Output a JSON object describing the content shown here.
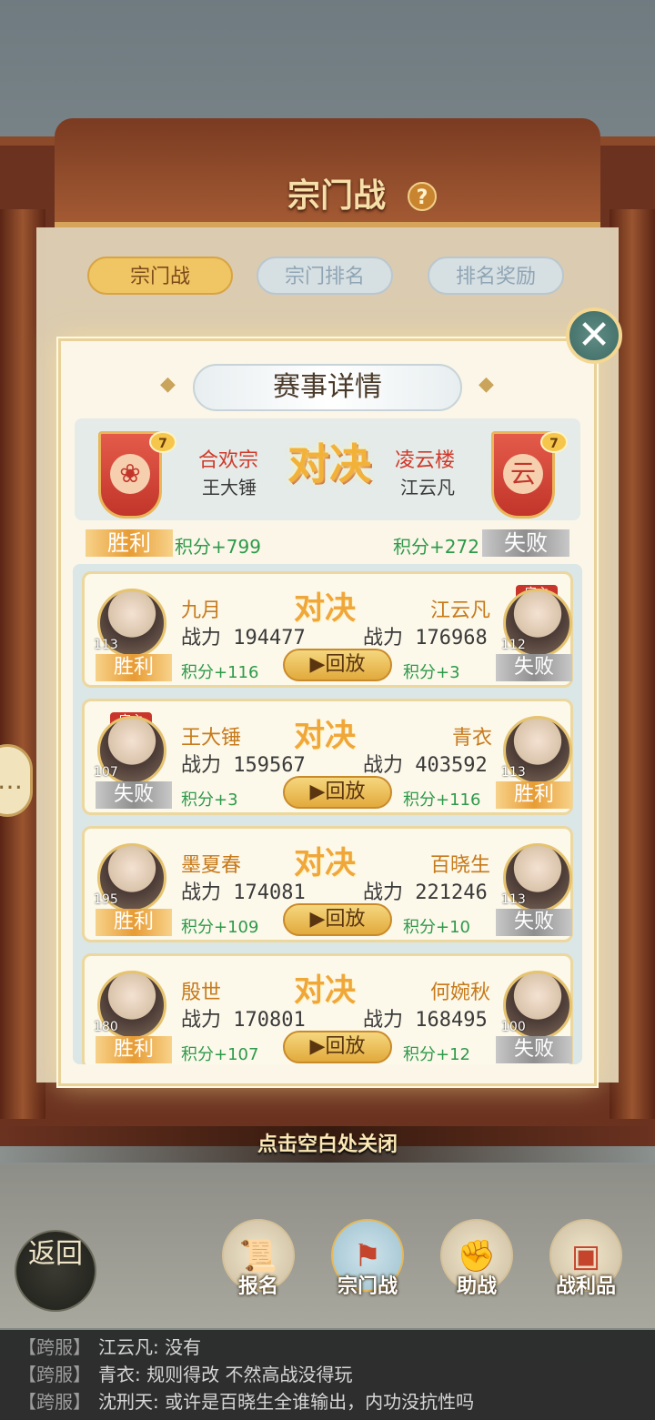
{
  "page": {
    "title": "宗门战",
    "help_icon": "question-icon"
  },
  "tabs": [
    {
      "label": "宗门战",
      "active": true
    },
    {
      "label": "宗门排名",
      "active": false
    },
    {
      "label": "排名奖励",
      "active": false
    }
  ],
  "modal": {
    "title": "赛事详情",
    "summary": {
      "left": {
        "sect": "合欢宗",
        "leader": "王大锤",
        "level": "7",
        "emblem": "lotus-icon",
        "result": "胜利",
        "score": "积分+799"
      },
      "right": {
        "sect": "凌云楼",
        "leader": "江云凡",
        "level": "7",
        "emblem_text": "云",
        "result": "失败",
        "score": "积分+272"
      },
      "versus": "对决"
    },
    "matches": [
      {
        "left": {
          "name": "九月",
          "power": "战力 194477",
          "level": "113",
          "result": "胜利",
          "score": "积分+116",
          "is_master": false
        },
        "right": {
          "name": "江云凡",
          "power": "战力 176968",
          "level": "112",
          "result": "失败",
          "score": "积分+3",
          "is_master": true
        },
        "versus": "对决",
        "replay": "回放"
      },
      {
        "left": {
          "name": "王大锤",
          "power": "战力 159567",
          "level": "107",
          "result": "失败",
          "score": "积分+3",
          "is_master": true
        },
        "right": {
          "name": "青衣",
          "power": "战力 403592",
          "level": "113",
          "result": "胜利",
          "score": "积分+116",
          "is_master": false
        },
        "versus": "对决",
        "replay": "回放"
      },
      {
        "left": {
          "name": "墨夏春",
          "power": "战力 174081",
          "level": "195",
          "result": "胜利",
          "score": "积分+109",
          "is_master": false
        },
        "right": {
          "name": "百晓生",
          "power": "战力 221246",
          "level": "113",
          "result": "失败",
          "score": "积分+10",
          "is_master": false
        },
        "versus": "对决",
        "replay": "回放"
      },
      {
        "left": {
          "name": "殷世",
          "power": "战力 170801",
          "level": "180",
          "result": "胜利",
          "score": "积分+107",
          "is_master": false
        },
        "right": {
          "name": "何婉秋",
          "power": "战力 168495",
          "level": "100",
          "result": "失败",
          "score": "积分+12",
          "is_master": false
        },
        "versus": "对决",
        "replay": "回放"
      }
    ],
    "master_tag": "宗主",
    "close_hint": "点击空白处关闭"
  },
  "bottom_nav": {
    "back": "返回",
    "items": [
      {
        "label": "报名",
        "icon": "scroll-icon"
      },
      {
        "label": "宗门战",
        "icon": "flag-mountain-icon",
        "active": true
      },
      {
        "label": "助战",
        "icon": "handshake-icon"
      },
      {
        "label": "战利品",
        "icon": "treasure-chest-icon"
      }
    ]
  },
  "chat": [
    {
      "tag": "【跨服】",
      "text": "江云凡: 没有"
    },
    {
      "tag": "【跨服】",
      "text": "青衣: 规则得改 不然高战没得玩"
    },
    {
      "tag": "【跨服】",
      "text": "沈刑天: 或许是百晓生全谁输出，内功没抗性吗"
    }
  ],
  "colors": {
    "win": "#e89c34",
    "lose": "#8f8f8f",
    "score": "#2e9a4a",
    "accent": "#c9352a"
  }
}
